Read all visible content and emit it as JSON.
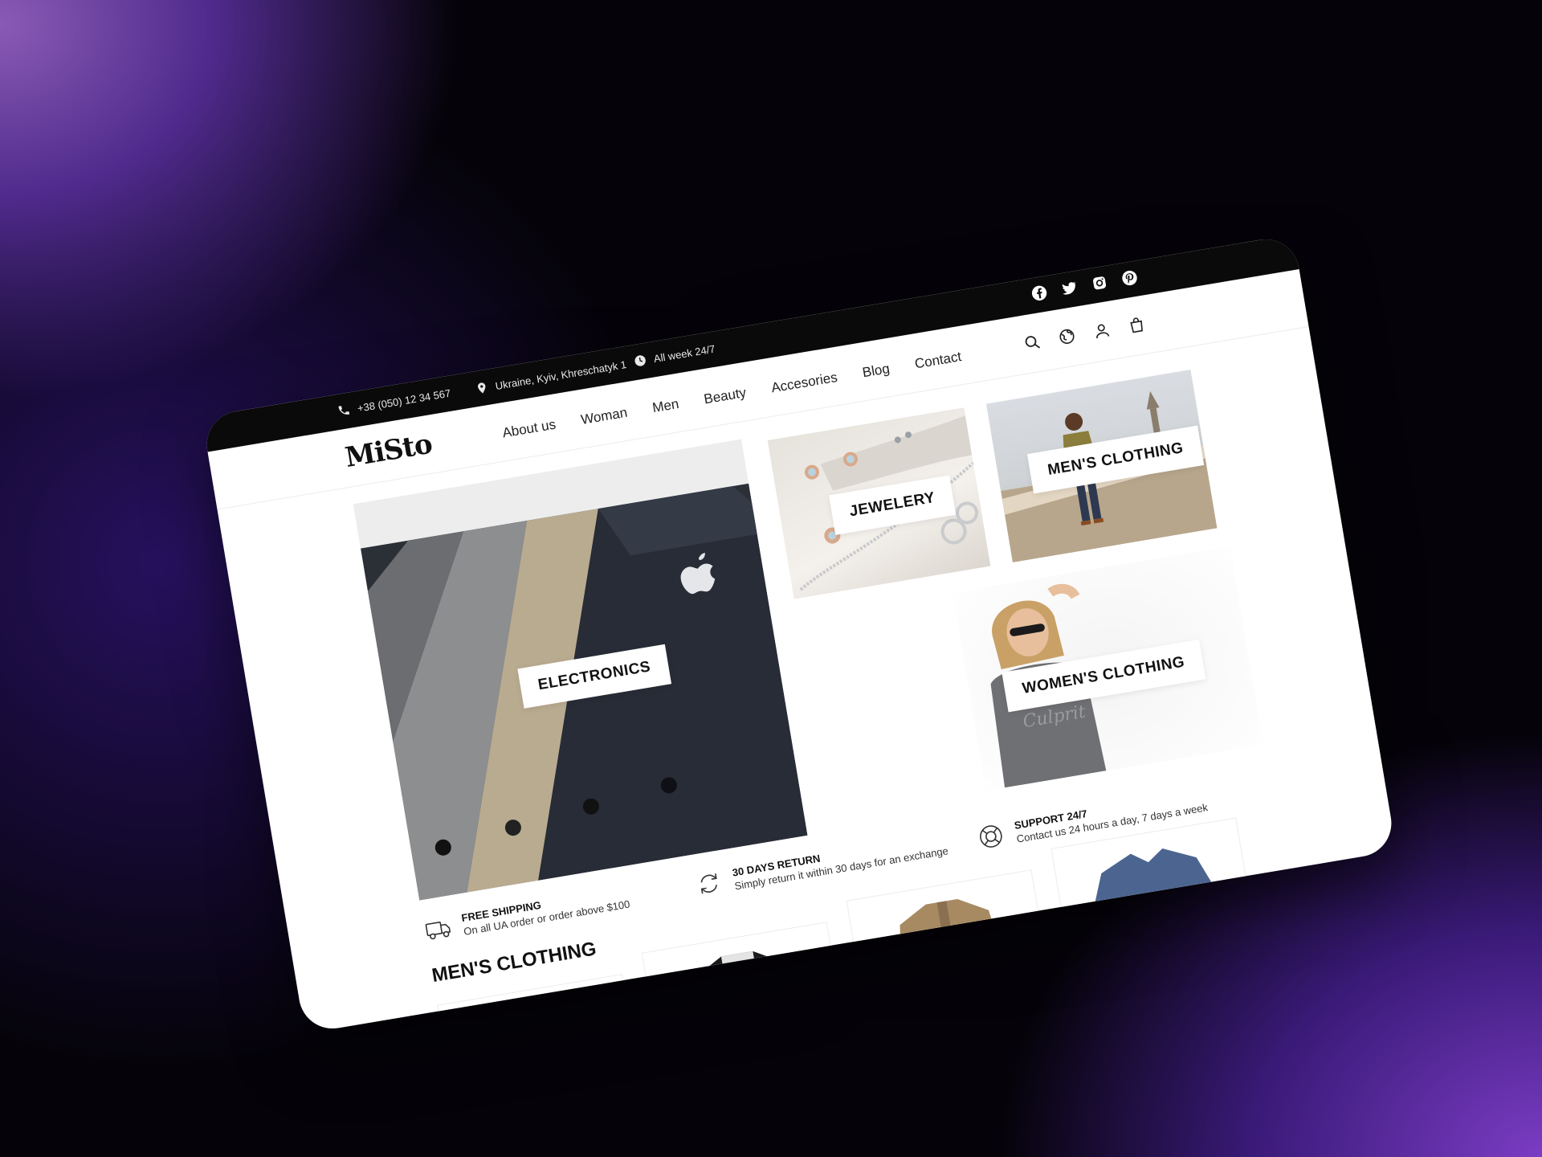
{
  "topbar": {
    "phone": "+38 (050) 12 34 567",
    "address": "Ukraine, Kyiv, Khreschatyk 1",
    "hours": "All week 24/7",
    "social": [
      "facebook-icon",
      "twitter-icon",
      "instagram-icon",
      "pinterest-icon"
    ]
  },
  "header": {
    "logo": "MiSto",
    "nav": [
      "About us",
      "Woman",
      "Men",
      "Beauty",
      "Accesories",
      "Blog",
      "Contact"
    ],
    "icons": [
      "search-icon",
      "globe-icon",
      "user-icon",
      "bag-icon"
    ]
  },
  "categories": {
    "electronics": "ELECTRONICS",
    "jewelery": "JEWELERY",
    "mens": "MEN'S CLOTHING",
    "womens": "WOMEN'S CLOTHING"
  },
  "features": [
    {
      "title": "FREE SHIPPING",
      "desc": "On all UA order or order above $100"
    },
    {
      "title": "30 DAYS RETURN",
      "desc": "Simply return it within 30 days for an exchange"
    },
    {
      "title": "SUPPORT 24/7",
      "desc": "Contact us 24 hours a day, 7 days a week"
    }
  ],
  "section": {
    "title": "MEN'S CLOTHING"
  },
  "colors": {
    "accent": "#0a0a0a",
    "background_purple": "#6a36b0"
  }
}
